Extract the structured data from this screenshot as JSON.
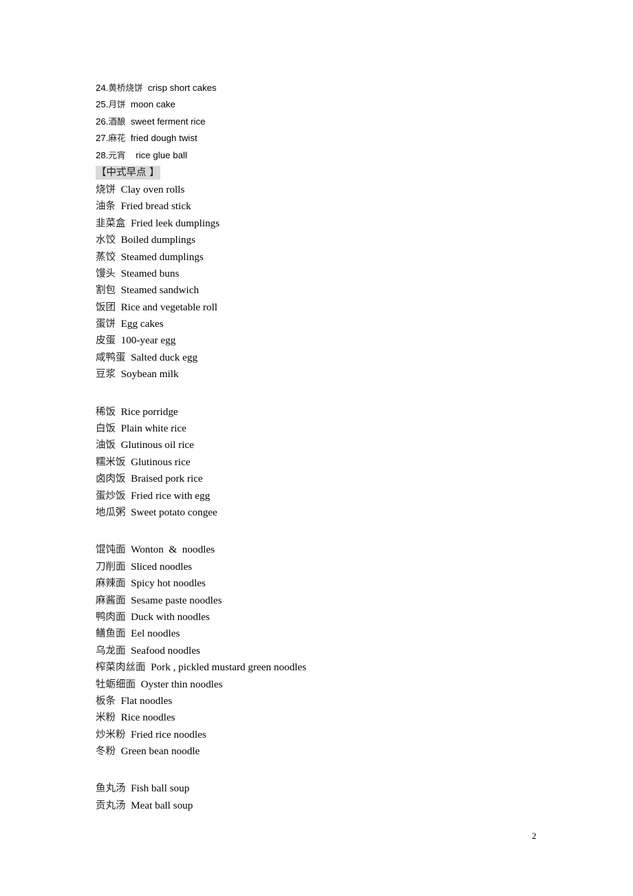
{
  "numbered_items": [
    {
      "num": "24.",
      "cn": "黄桥烧饼",
      "en": "crisp short cakes",
      "sep": "  "
    },
    {
      "num": "25.",
      "cn": "月饼",
      "en": "moon cake",
      "sep": "  "
    },
    {
      "num": "26.",
      "cn": "酒酿",
      "en": "sweet ferment rice",
      "sep": "  "
    },
    {
      "num": "27.",
      "cn": "麻花",
      "en": "fried dough twist",
      "sep": "  "
    },
    {
      "num": "28.",
      "cn": "元宵",
      "en": "rice glue ball",
      "sep": "    "
    }
  ],
  "section_heading": "【中式早点 】",
  "groups": [
    {
      "name": "breakfast-items",
      "items": [
        {
          "cn": "烧饼",
          "en": "Clay oven rolls"
        },
        {
          "cn": "油条",
          "en": "Fried bread stick"
        },
        {
          "cn": "韭菜盒",
          "en": "Fried leek dumplings"
        },
        {
          "cn": "水饺",
          "en": "Boiled dumplings"
        },
        {
          "cn": "蒸饺",
          "en": "Steamed dumplings"
        },
        {
          "cn": "馒头",
          "en": "Steamed buns"
        },
        {
          "cn": "割包",
          "en": "Steamed sandwich"
        },
        {
          "cn": "饭团",
          "en": "Rice and vegetable roll"
        },
        {
          "cn": "蛋饼",
          "en": "Egg cakes"
        },
        {
          "cn": "皮蛋",
          "en": "100-year egg"
        },
        {
          "cn": "咸鸭蛋",
          "en": "Salted duck egg"
        },
        {
          "cn": "豆浆",
          "en": "Soybean milk"
        }
      ]
    },
    {
      "name": "rice-items",
      "items": [
        {
          "cn": "稀饭",
          "en": "Rice porridge"
        },
        {
          "cn": "白饭",
          "en": "Plain white rice"
        },
        {
          "cn": "油饭",
          "en": "Glutinous oil rice"
        },
        {
          "cn": "糯米饭",
          "en": "Glutinous rice"
        },
        {
          "cn": "卤肉饭",
          "en": "Braised pork rice"
        },
        {
          "cn": "蛋炒饭",
          "en": "Fried rice with egg"
        },
        {
          "cn": "地瓜粥",
          "en": "Sweet potato congee"
        }
      ]
    },
    {
      "name": "noodle-items",
      "items": [
        {
          "cn": "馄饨面",
          "en": "Wonton  &  noodles"
        },
        {
          "cn": "刀削面",
          "en": "Sliced noodles"
        },
        {
          "cn": "麻辣面",
          "en": "Spicy hot noodles"
        },
        {
          "cn": "麻酱面",
          "en": "Sesame paste noodles"
        },
        {
          "cn": "鸭肉面",
          "en": "Duck with noodles"
        },
        {
          "cn": "鳝鱼面",
          "en": "Eel noodles"
        },
        {
          "cn": "乌龙面",
          "en": "Seafood noodles"
        },
        {
          "cn": "榨菜肉丝面",
          "en": "Pork , pickled mustard green noodles"
        },
        {
          "cn": "牡蛎细面",
          "en": "Oyster thin noodles"
        },
        {
          "cn": "板条",
          "en": "Flat noodles"
        },
        {
          "cn": "米粉",
          "en": "Rice noodles"
        },
        {
          "cn": "炒米粉",
          "en": "Fried rice noodles"
        },
        {
          "cn": "冬粉",
          "en": "Green bean noodle"
        }
      ]
    },
    {
      "name": "soup-items",
      "items": [
        {
          "cn": "鱼丸汤",
          "en": "Fish ball soup"
        },
        {
          "cn": "贡丸汤",
          "en": "Meat ball soup"
        }
      ]
    }
  ],
  "page_number": "2"
}
